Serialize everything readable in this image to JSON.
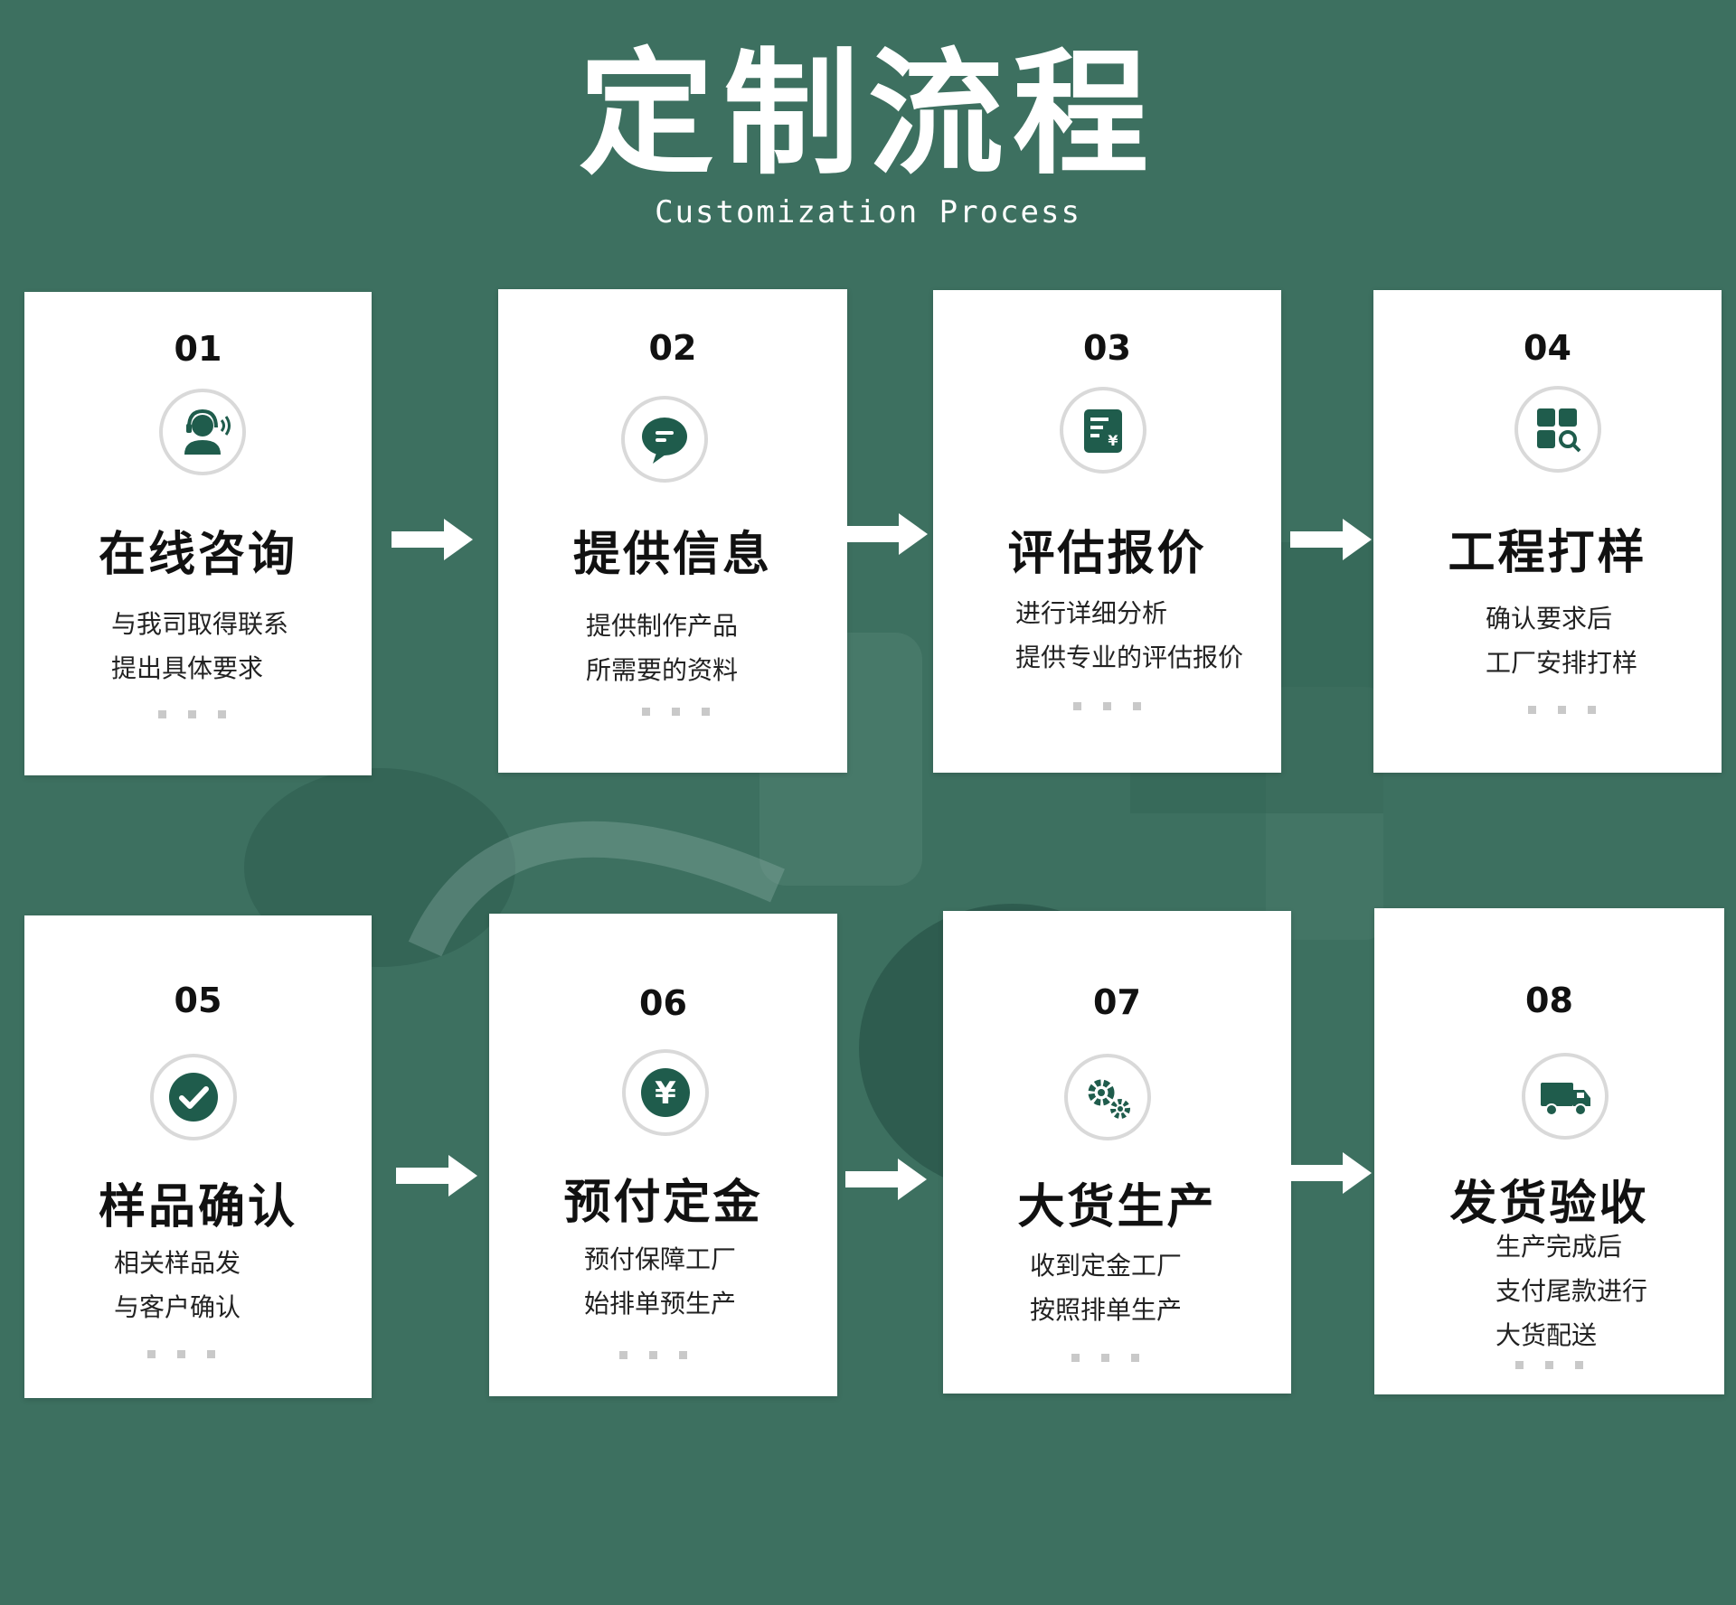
{
  "header": {
    "title": "定制流程",
    "subtitle": "Customization Process"
  },
  "steps": [
    {
      "number": "01",
      "title": "在线咨询",
      "icon": "customer-service-headset-icon",
      "lines": [
        "与我司取得联系",
        "提出具体要求"
      ]
    },
    {
      "number": "02",
      "title": "提供信息",
      "icon": "chat-bubble-icon",
      "lines": [
        "提供制作产品",
        "所需要的资料"
      ]
    },
    {
      "number": "03",
      "title": "评估报价",
      "icon": "quote-document-icon",
      "lines": [
        "进行详细分析",
        "提供专业的评估报价"
      ]
    },
    {
      "number": "04",
      "title": "工程打样",
      "icon": "grid-search-icon",
      "lines": [
        "确认要求后",
        "工厂安排打样"
      ]
    },
    {
      "number": "05",
      "title": "样品确认",
      "icon": "check-circle-icon",
      "lines": [
        "相关样品发",
        "与客户确认"
      ]
    },
    {
      "number": "06",
      "title": "预付定金",
      "icon": "yen-coin-icon",
      "lines": [
        "预付保障工厂",
        "始排单预生产"
      ]
    },
    {
      "number": "07",
      "title": "大货生产",
      "icon": "gears-icon",
      "lines": [
        "收到定金工厂",
        "按照排单生产"
      ]
    },
    {
      "number": "08",
      "title": "发货验收",
      "icon": "delivery-truck-icon",
      "lines": [
        "生产完成后",
        "支付尾款进行",
        "大货配送"
      ]
    }
  ],
  "colors": {
    "background": "#3d7060",
    "card": "#ffffff",
    "icon_fill": "#1f5c4c",
    "text": "#111111",
    "dots": "#c9c9c9"
  }
}
